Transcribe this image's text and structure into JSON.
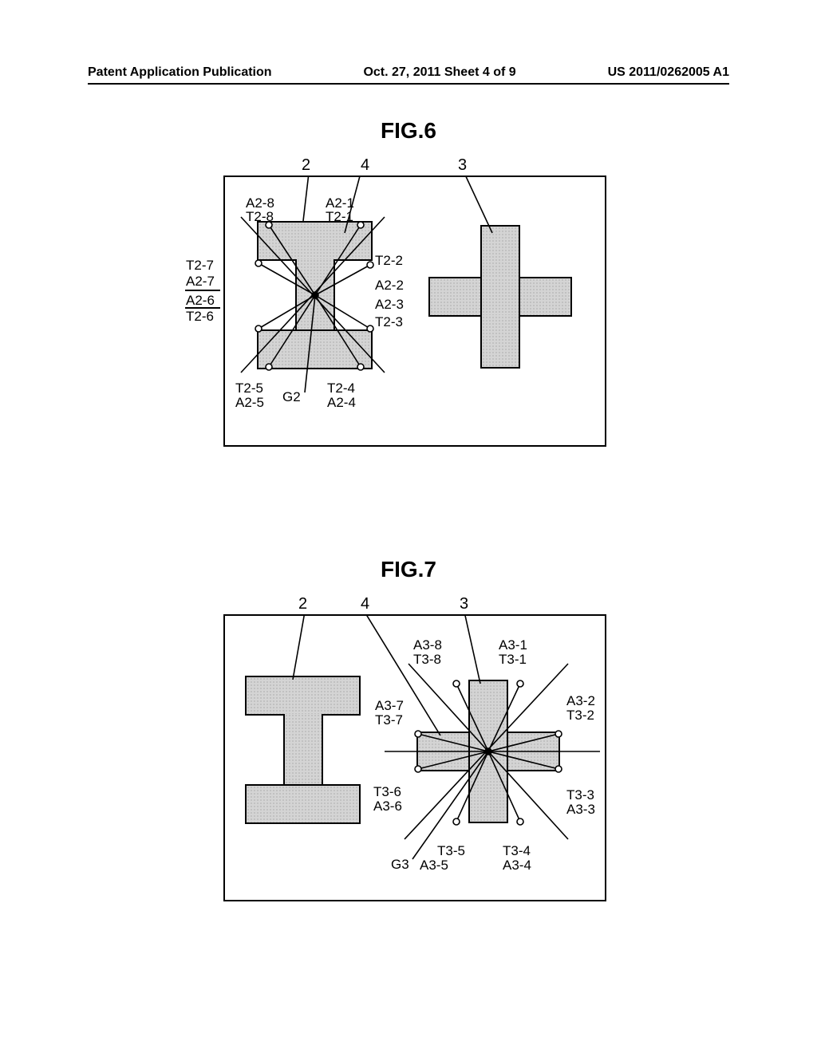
{
  "header": {
    "left": "Patent Application Publication",
    "center": "Oct. 27, 2011  Sheet 4 of 9",
    "right": "US 2011/0262005 A1"
  },
  "figures": {
    "fig6": {
      "title": "FIG.6",
      "callouts": {
        "c2": "2",
        "c4": "4",
        "c3": "3"
      },
      "labels": {
        "l_a28": "A2-8",
        "l_t28": "T2-8",
        "l_a21": "A2-1",
        "l_t21": "T2-1",
        "l_t27": "T2-7",
        "l_a27": "A2-7",
        "l_a26": "A2-6",
        "l_t26": "T2-6",
        "l_t22": "T2-2",
        "l_a22": "A2-2",
        "l_a23": "A2-3",
        "l_t23": "T2-3",
        "l_t25": "T2-5",
        "l_a25": "A2-5",
        "l_g2": "G2",
        "l_t24": "T2-4",
        "l_a24": "A2-4"
      }
    },
    "fig7": {
      "title": "FIG.7",
      "callouts": {
        "c2": "2",
        "c4": "4",
        "c3": "3"
      },
      "labels": {
        "l_a38": "A3-8",
        "l_t38": "T3-8",
        "l_a31": "A3-1",
        "l_t31": "T3-1",
        "l_a37": "A3-7",
        "l_t37": "T3-7",
        "l_a32": "A3-2",
        "l_t32": "T3-2",
        "l_t36": "T3-6",
        "l_a36": "A3-6",
        "l_t33": "T3-3",
        "l_a33": "A3-3",
        "l_g3": "G3",
        "l_t35": "T3-5",
        "l_a35": "A3-5",
        "l_t34": "T3-4",
        "l_a34": "A3-4"
      }
    }
  }
}
